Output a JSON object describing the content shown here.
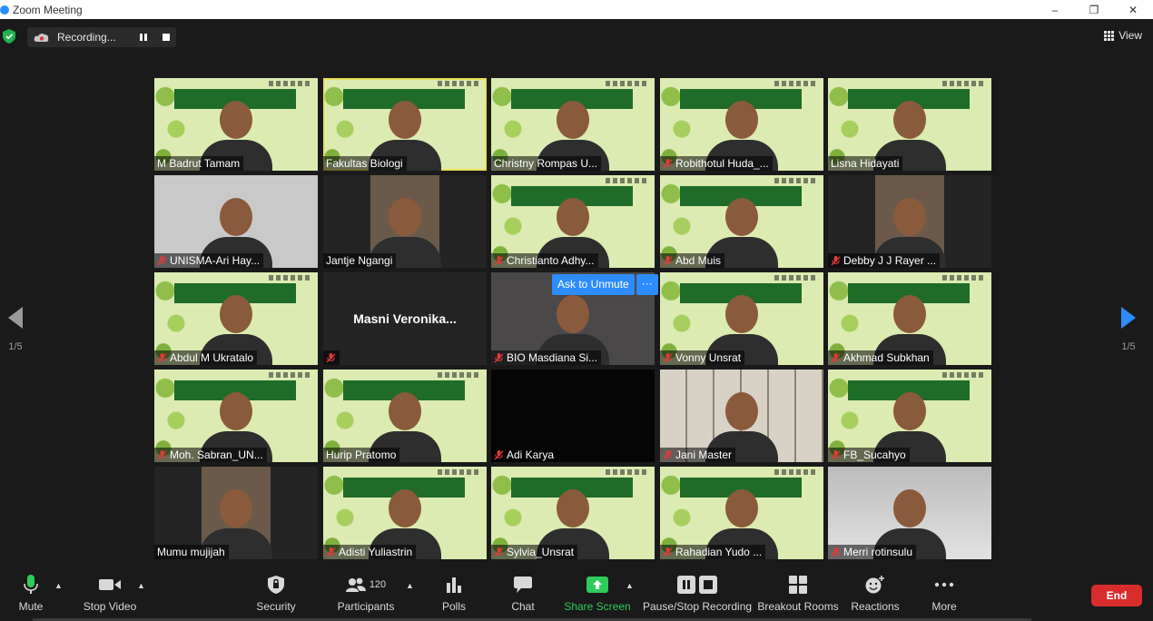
{
  "window": {
    "title": "Zoom Meeting",
    "controls": {
      "minimize": "–",
      "restore": "❐",
      "close": "✕"
    }
  },
  "topbar": {
    "recording_label": "Recording...",
    "view_label": "View"
  },
  "gallery": {
    "page_label": "1/5",
    "unmute_prompt": {
      "label": "Ask to Unmute",
      "more": "···"
    },
    "tiles": [
      {
        "name": "M Badrut Tamam",
        "muted": false,
        "bg": "green"
      },
      {
        "name": "Fakultas Biologi",
        "muted": false,
        "bg": "green",
        "active": true
      },
      {
        "name": "Christny Rompas U...",
        "muted": false,
        "bg": "green"
      },
      {
        "name": "Robithotul Huda_...",
        "muted": true,
        "bg": "green"
      },
      {
        "name": "Lisna Hidayati",
        "muted": false,
        "bg": "green"
      },
      {
        "name": "UNISMA-Ari Hay...",
        "muted": true,
        "bg": "grey"
      },
      {
        "name": "Jantje Ngangi",
        "muted": false,
        "bg": "dark",
        "inset": true
      },
      {
        "name": "Christianto Adhy...",
        "muted": true,
        "bg": "green"
      },
      {
        "name": "Abd Muis",
        "muted": true,
        "bg": "green"
      },
      {
        "name": "Debby J J Rayer ...",
        "muted": true,
        "bg": "dark",
        "inset": true
      },
      {
        "name": "Abdul M Ukratalo",
        "muted": true,
        "bg": "green"
      },
      {
        "name": "Masni Veronika...",
        "muted": true,
        "bg": "dark",
        "no_video": true
      },
      {
        "name": "BIO Masdiana Si...",
        "muted": true,
        "bg": "room"
      },
      {
        "name": "Vonny Unsrat",
        "muted": true,
        "bg": "green"
      },
      {
        "name": "Akhmad Subkhan",
        "muted": true,
        "bg": "green"
      },
      {
        "name": "Moh. Sabran_UN...",
        "muted": true,
        "bg": "green"
      },
      {
        "name": "Hurip Pratomo",
        "muted": false,
        "bg": "green"
      },
      {
        "name": "Adi Karya",
        "muted": true,
        "bg": "black"
      },
      {
        "name": "Jani Master",
        "muted": true,
        "bg": "shelf"
      },
      {
        "name": "FB_Sucahyo",
        "muted": true,
        "bg": "green"
      },
      {
        "name": "Mumu mujijah",
        "muted": false,
        "bg": "dark",
        "inset": true
      },
      {
        "name": "Adisti Yuliastrin",
        "muted": true,
        "bg": "green"
      },
      {
        "name": "Sylvia_Unsrat",
        "muted": true,
        "bg": "green"
      },
      {
        "name": "Rahadian Yudo ...",
        "muted": true,
        "bg": "green"
      },
      {
        "name": "Merri rotinsulu",
        "muted": true,
        "bg": "gradient"
      }
    ]
  },
  "toolbar": {
    "mute": "Mute",
    "stop_video": "Stop Video",
    "security": "Security",
    "participants": "Participants",
    "participants_count": "120",
    "polls": "Polls",
    "chat": "Chat",
    "share_screen": "Share Screen",
    "recording": "Pause/Stop Recording",
    "breakout_rooms": "Breakout Rooms",
    "reactions": "Reactions",
    "more": "More",
    "end": "End"
  },
  "colors": {
    "accent_blue": "#2d8cff",
    "share_green": "#2ecb5a",
    "end_red": "#d92d2d",
    "active_speaker": "#e9e05a",
    "muted_red": "#e03b3b"
  }
}
